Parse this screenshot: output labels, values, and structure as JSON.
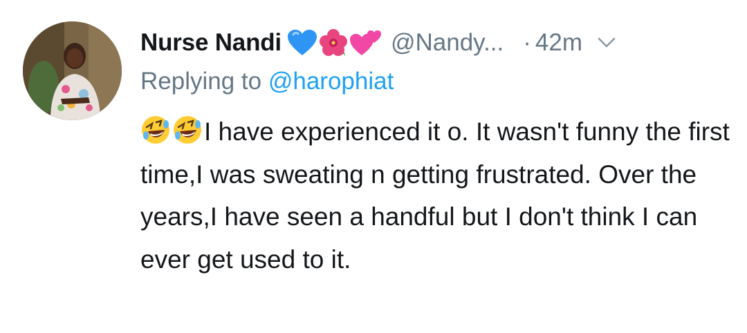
{
  "tweet": {
    "display_name": "Nurse Nandi",
    "name_emojis": [
      "blue-heart-icon",
      "hibiscus-icon",
      "two-hearts-icon"
    ],
    "handle": "@Nandy...",
    "separator": "·",
    "time": "42m",
    "reply_prefix": "Replying to",
    "reply_handle": "@harophiat",
    "body_emojis": [
      "rolling-laughing-icon",
      "rolling-laughing-icon"
    ],
    "body_text": "I have experienced it o. It wasn't funny the first time,I was sweating n getting frustrated. Over the years,I have seen a handful but I don't think I can ever get used to it."
  },
  "colors": {
    "name": "#14171a",
    "meta": "#657786",
    "link": "#1da1f2",
    "background": "#ffffff"
  }
}
